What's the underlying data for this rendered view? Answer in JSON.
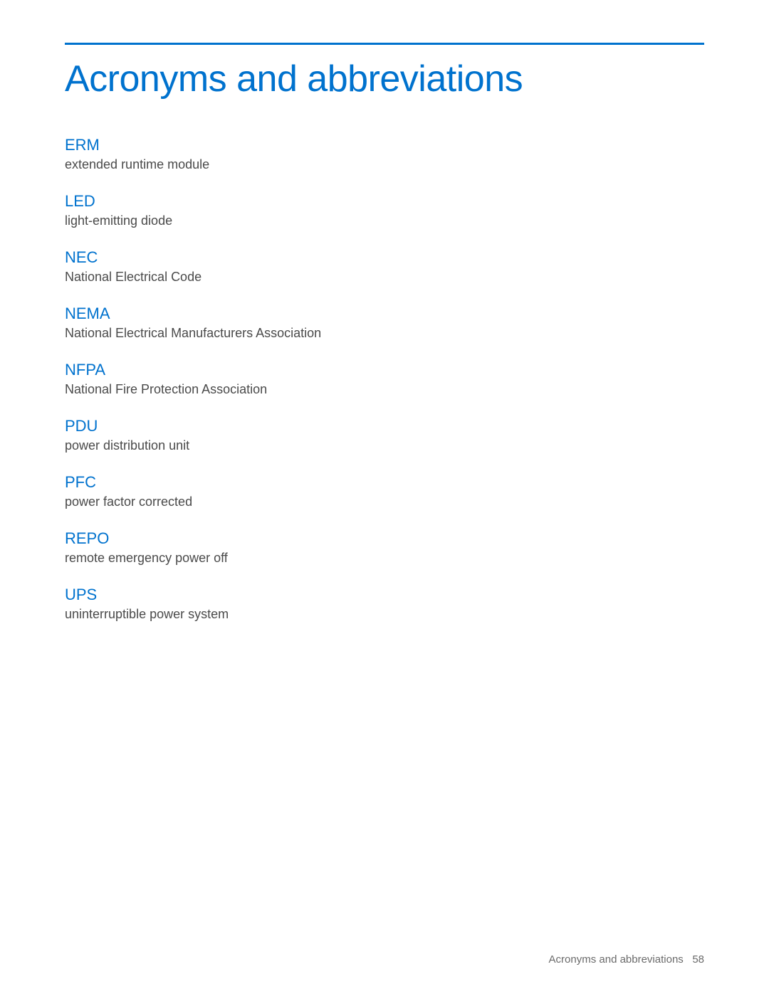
{
  "page": {
    "title": "Acronyms and abbreviations",
    "footer_text": "Acronyms and abbreviations",
    "footer_page": "58"
  },
  "acronyms": [
    {
      "term": "ERM",
      "definition": "extended runtime module"
    },
    {
      "term": "LED",
      "definition": "light-emitting diode"
    },
    {
      "term": "NEC",
      "definition": "National Electrical Code"
    },
    {
      "term": "NEMA",
      "definition": "National Electrical Manufacturers Association"
    },
    {
      "term": "NFPA",
      "definition": "National Fire Protection Association"
    },
    {
      "term": "PDU",
      "definition": "power distribution unit"
    },
    {
      "term": "PFC",
      "definition": "power factor corrected"
    },
    {
      "term": "REPO",
      "definition": "remote emergency power off"
    },
    {
      "term": "UPS",
      "definition": "uninterruptible power system"
    }
  ]
}
